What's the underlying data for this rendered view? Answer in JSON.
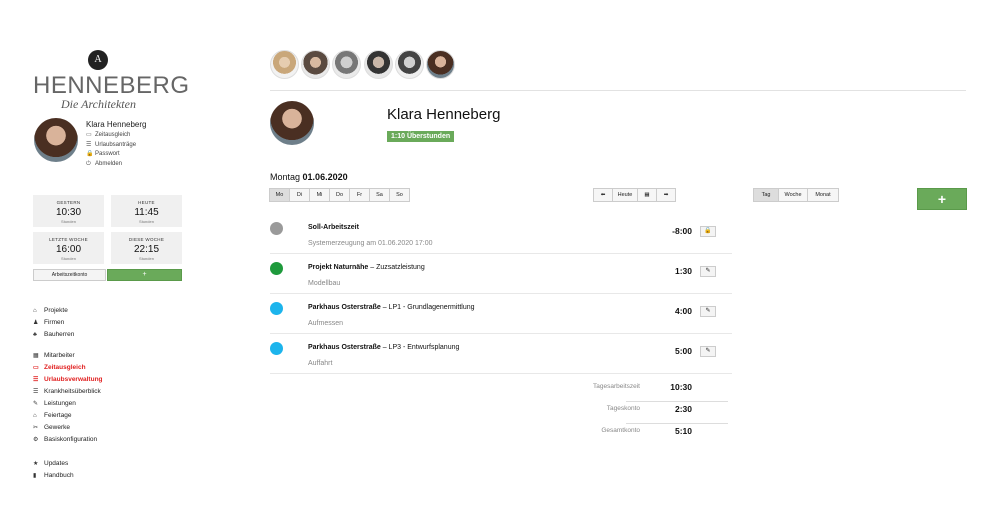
{
  "brand": {
    "name": "HENNEBERG",
    "subtitle": "Die Architekten",
    "mark": "A"
  },
  "user": {
    "name": "Klara Henneberg",
    "links": [
      {
        "icon": "timer-icon",
        "glyph": "▭",
        "label": "Zeitausgleich"
      },
      {
        "icon": "list-icon",
        "glyph": "☰",
        "label": "Urlaubsanträge"
      },
      {
        "icon": "lock-icon",
        "glyph": "🔒",
        "label": "Passwort"
      },
      {
        "icon": "power-icon",
        "glyph": "⏻",
        "label": "Abmelden"
      }
    ]
  },
  "stats": [
    {
      "label": "GESTERN",
      "value": "10:30",
      "unit": "Stunden"
    },
    {
      "label": "HEUTE",
      "value": "11:45",
      "unit": "Stunden"
    },
    {
      "label": "LETZTE WOCHE",
      "value": "16:00",
      "unit": "Stunden"
    },
    {
      "label": "DIESE WOCHE",
      "value": "22:15",
      "unit": "Stunden"
    }
  ],
  "konto_button": "Arbeitszeitkonto",
  "add_small": "+",
  "nav_group1": [
    {
      "icon": "home-icon",
      "glyph": "⌂",
      "label": "Projekte",
      "active": false
    },
    {
      "icon": "firm-icon",
      "glyph": "♟",
      "label": "Firmen",
      "active": false
    },
    {
      "icon": "clients-icon",
      "glyph": "♣",
      "label": "Bauherren",
      "active": false
    }
  ],
  "nav_group2": [
    {
      "icon": "staff-icon",
      "glyph": "▦",
      "label": "Mitarbeiter",
      "active": false
    },
    {
      "icon": "timer-icon",
      "glyph": "▭",
      "label": "Zeitausgleich",
      "active": true
    },
    {
      "icon": "vacation-icon",
      "glyph": "☰",
      "label": "Urlaubsverwaltung",
      "active": true
    },
    {
      "icon": "sick-icon",
      "glyph": "☰",
      "label": "Krankheitsüberblick",
      "active": false
    },
    {
      "icon": "wrench-icon",
      "glyph": "✎",
      "label": "Leistungen",
      "active": false
    },
    {
      "icon": "house-icon",
      "glyph": "⌂",
      "label": "Feiertage",
      "active": false
    },
    {
      "icon": "trade-icon",
      "glyph": "✂",
      "label": "Gewerke",
      "active": false
    },
    {
      "icon": "gear-icon",
      "glyph": "⚙",
      "label": "Basiskonfiguration",
      "active": false
    }
  ],
  "nav_group3": [
    {
      "icon": "star-icon",
      "glyph": "★",
      "label": "Updates",
      "active": false
    },
    {
      "icon": "book-icon",
      "glyph": "▮",
      "label": "Handbuch",
      "active": false
    }
  ],
  "profile": {
    "name": "Klara Henneberg",
    "overtime": "1:10 Überstunden"
  },
  "date": {
    "weekday": "Montag",
    "date": "01.06.2020"
  },
  "days": [
    "Mo",
    "Di",
    "Mi",
    "Do",
    "Fr",
    "Sa",
    "So"
  ],
  "day_selected": 0,
  "nav_buttons": {
    "prev": "⬅",
    "today": "Heute",
    "calendar": "▦",
    "next": "➡"
  },
  "views": [
    "Tag",
    "Woche",
    "Monat"
  ],
  "view_selected": 0,
  "add_big": "+",
  "entries": [
    {
      "color": "#9a9a9a",
      "title_bold": "Soll-Arbeitszeit",
      "title_rest": "",
      "sub": "Systemerzeugung am 01.06.2020 17:00",
      "time": "-8:00",
      "btn": "🔒",
      "btn_icon": "lock-icon"
    },
    {
      "color": "#1e9a3c",
      "title_bold": "Projekt Naturnähe",
      "title_rest": " – Zuzsatzleistung",
      "sub": "Modellbau",
      "time": "1:30",
      "btn": "✎",
      "btn_icon": "pencil-icon"
    },
    {
      "color": "#1cb4ec",
      "title_bold": "Parkhaus Osterstraße",
      "title_rest": " – LP1 - Grundlagenermittlung",
      "sub": "Aufmessen",
      "time": "4:00",
      "btn": "✎",
      "btn_icon": "pencil-icon"
    },
    {
      "color": "#1cb4ec",
      "title_bold": "Parkhaus Osterstraße",
      "title_rest": " – LP3 - Entwurfsplanung",
      "sub": "Auffahrt",
      "time": "5:00",
      "btn": "✎",
      "btn_icon": "pencil-icon"
    }
  ],
  "totals": [
    {
      "label": "Tagesarbeitszeit",
      "value": "10:30"
    },
    {
      "label": "Tageskonto",
      "value": "2:30"
    },
    {
      "label": "Gesamtkonto",
      "value": "5:10"
    }
  ]
}
